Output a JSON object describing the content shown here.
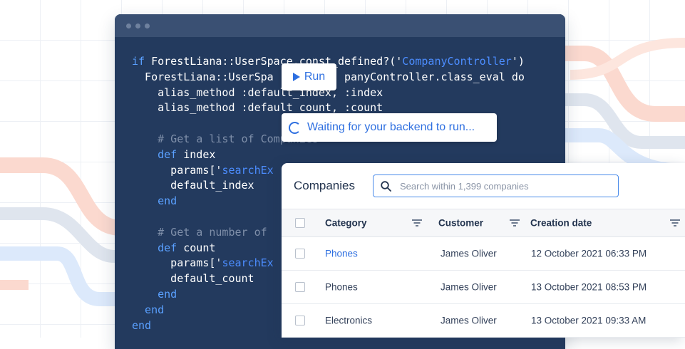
{
  "editor": {
    "lines": [
      [
        {
          "t": "if ",
          "c": "kw"
        },
        {
          "t": "ForestLiana::UserSpace.const_defined?('"
        },
        {
          "t": "CompanyController",
          "c": "str"
        },
        {
          "t": "')"
        }
      ],
      [
        {
          "t": "  ForestLiana::UserSpa"
        },
        {
          "t": "           "
        },
        {
          "t": "panyController.class_eval do"
        }
      ],
      [
        {
          "t": "    alias_method :default_index, :index"
        }
      ],
      [
        {
          "t": "    alias_method :default_count, :count"
        }
      ],
      [
        {
          "t": ""
        }
      ],
      [
        {
          "t": "    # Get a list of Companies",
          "c": "cm"
        }
      ],
      [
        {
          "t": "    def ",
          "c": "kw"
        },
        {
          "t": "index"
        }
      ],
      [
        {
          "t": "      params['"
        },
        {
          "t": "searchEx",
          "c": "str"
        }
      ],
      [
        {
          "t": "      default_index"
        }
      ],
      [
        {
          "t": "    end",
          "c": "kw"
        }
      ],
      [
        {
          "t": ""
        }
      ],
      [
        {
          "t": "    # Get a number of",
          "c": "cm"
        }
      ],
      [
        {
          "t": "    def ",
          "c": "kw"
        },
        {
          "t": "count"
        }
      ],
      [
        {
          "t": "      params['"
        },
        {
          "t": "searchEx",
          "c": "str"
        }
      ],
      [
        {
          "t": "      default_count"
        }
      ],
      [
        {
          "t": "    end",
          "c": "kw"
        }
      ],
      [
        {
          "t": "  end",
          "c": "kw"
        }
      ],
      [
        {
          "t": "end",
          "c": "kw"
        }
      ]
    ]
  },
  "run_button": {
    "label": "Run"
  },
  "waiting": {
    "label": "Waiting for your backend to run..."
  },
  "companies": {
    "title": "Companies",
    "search_placeholder": "Search within 1,399 companies",
    "columns": [
      "Category",
      "Customer",
      "Creation date"
    ],
    "rows": [
      {
        "category": "Phones",
        "customer": "James Oliver",
        "date": "12 October 2021 06:33 PM",
        "link": true
      },
      {
        "category": "Phones",
        "customer": "James Oliver",
        "date": "13 October 2021 08:53 PM",
        "link": false
      },
      {
        "category": "Electronics",
        "customer": "James Oliver",
        "date": "13 October 2021 09:33 AM",
        "link": false
      }
    ]
  },
  "colors": {
    "accent": "#2e6fe0",
    "editor_bg": "#233a5e",
    "keyword": "#5aa0ff",
    "comment": "#7f8fa9"
  }
}
